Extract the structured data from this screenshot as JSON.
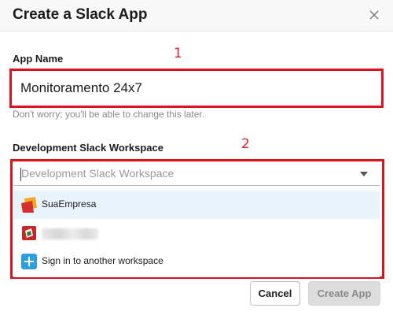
{
  "dialog": {
    "title": "Create a Slack App",
    "close_icon": "close-icon"
  },
  "app_name": {
    "label": "App Name",
    "value": "Monitoramento 24x7",
    "hint": "Don't worry; you'll be able to change this later."
  },
  "workspace": {
    "label": "Development Slack Workspace",
    "placeholder": "Development Slack Workspace",
    "options": [
      {
        "label": "SuaEmpresa",
        "icon": "workspace-logo-icon",
        "selected": true
      },
      {
        "label": "",
        "icon": "workspace-logo-icon",
        "selected": false
      },
      {
        "label": "Sign in to another workspace",
        "icon": "plus-icon",
        "selected": false
      }
    ]
  },
  "annotations": {
    "one": "1",
    "two": "2"
  },
  "footer": {
    "cancel_label": "Cancel",
    "create_label": "Create App"
  },
  "colors": {
    "annotation_red": "#d9141c",
    "selected_option_bg": "#e9f3fb",
    "plus_blue": "#2d9ee0"
  }
}
